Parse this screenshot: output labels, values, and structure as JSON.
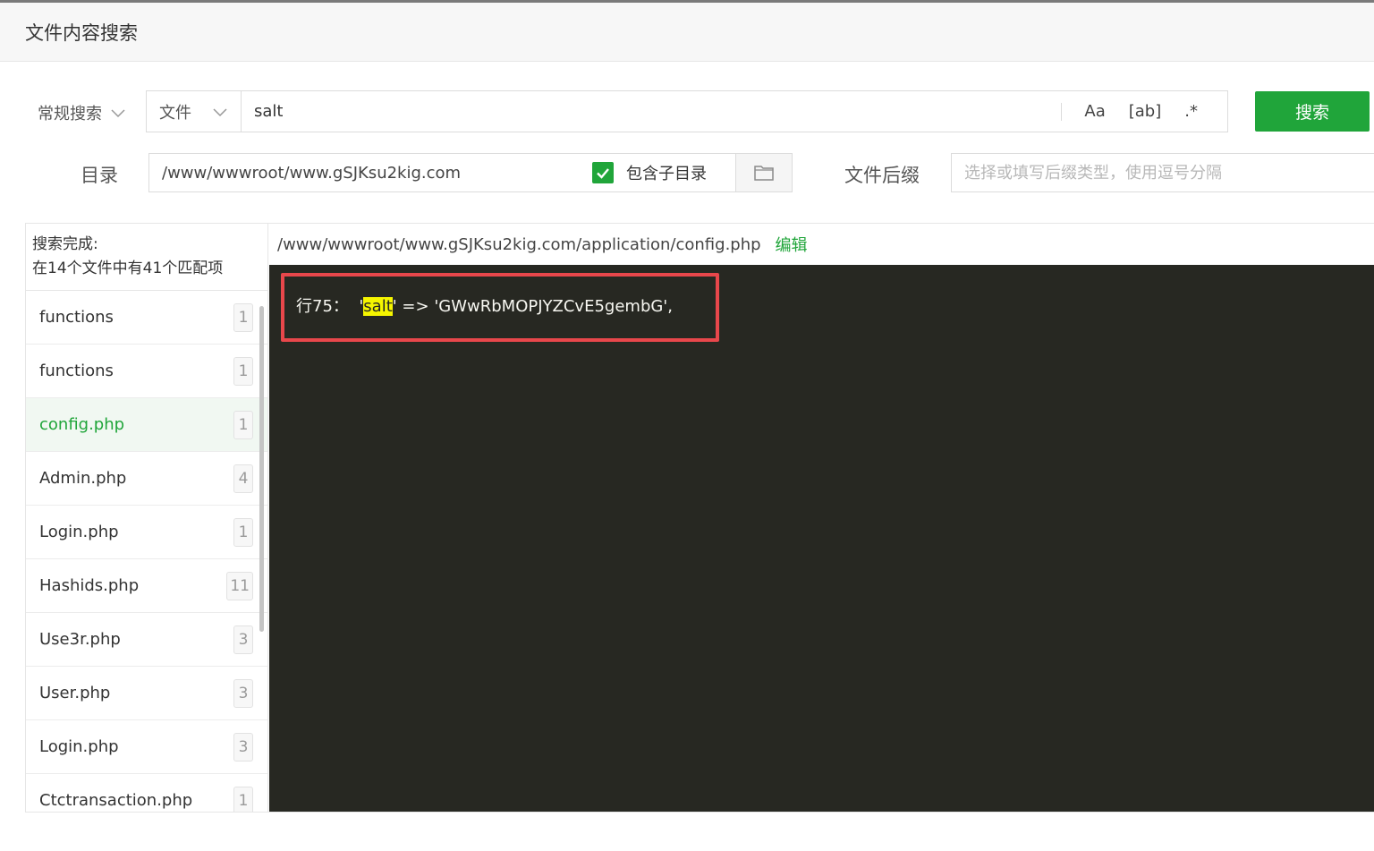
{
  "header": {
    "title": "文件内容搜索"
  },
  "search": {
    "mode": "常规搜索",
    "scope": "文件",
    "keyword": "salt",
    "options": [
      "Aa",
      "[ab]",
      ".*"
    ],
    "button_label": "搜索"
  },
  "directory": {
    "label": "目录",
    "path": "/www/wwwroot/www.gSJKsu2kig.com",
    "include_subdirs_label": "包含子目录",
    "include_subdirs": true,
    "suffix_label": "文件后缀",
    "suffix_placeholder": "选择或填写后缀类型，使用逗号分隔"
  },
  "results": {
    "status": "搜索完成:",
    "summary": "在14个文件中有41个匹配项",
    "files": [
      {
        "name": "functions",
        "count": "1"
      },
      {
        "name": "functions",
        "count": "1"
      },
      {
        "name": "config.php",
        "count": "1"
      },
      {
        "name": "Admin.php",
        "count": "4"
      },
      {
        "name": "Login.php",
        "count": "1"
      },
      {
        "name": "Hashids.php",
        "count": "11"
      },
      {
        "name": "Use3r.php",
        "count": "3"
      },
      {
        "name": "User.php",
        "count": "3"
      },
      {
        "name": "Login.php",
        "count": "3"
      },
      {
        "name": "Ctctransaction.php",
        "count": "1"
      }
    ],
    "active_index": 2
  },
  "preview": {
    "file_path": "/www/wwwroot/www.gSJKsu2kig.com/application/config.php",
    "edit_label": "编辑",
    "line_prefix": "行75：  '",
    "match": "salt",
    "line_suffix": "' => 'GWwRbMOPJYZCvE5gembG',"
  },
  "colors": {
    "accent": "#20a53a",
    "code_bg": "#272822",
    "highlight_border": "#e8474b",
    "match_bg": "#f5f500"
  },
  "icons": {
    "dropdown": "chevron-down-icon",
    "check": "check-icon",
    "folder": "folder-icon"
  },
  "footer": {
    "hint": ""
  }
}
